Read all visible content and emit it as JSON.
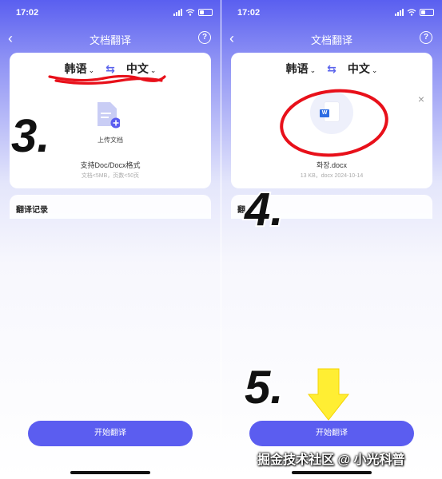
{
  "status_bar": {
    "time": "17:02"
  },
  "nav": {
    "back": "‹",
    "title": "文档翻译",
    "help": "?"
  },
  "languages": {
    "source": "韩语",
    "target": "中文",
    "caret": "⌄",
    "swap": "⇆"
  },
  "left_screen": {
    "upload_label": "上传文档",
    "support_text": "支持Doc/Docx格式",
    "limit_text": "文档<5MB，页数<50页",
    "history_title": "翻译记录",
    "start_button": "开始翻译"
  },
  "right_screen": {
    "file_badge": "W",
    "file_name": "화장.docx",
    "file_meta": "13 KB，docx 2024-10-14",
    "history_title": "翻",
    "start_button": "开始翻译",
    "close": "×"
  },
  "annotations": {
    "step3": "3.",
    "step4": "4.",
    "step5": "5."
  },
  "watermark": "掘金技术社区 @ 小光科普",
  "colors": {
    "accent": "#5b5df0",
    "annotation_red": "#e8101a",
    "arrow_yellow": "#ffee33"
  }
}
